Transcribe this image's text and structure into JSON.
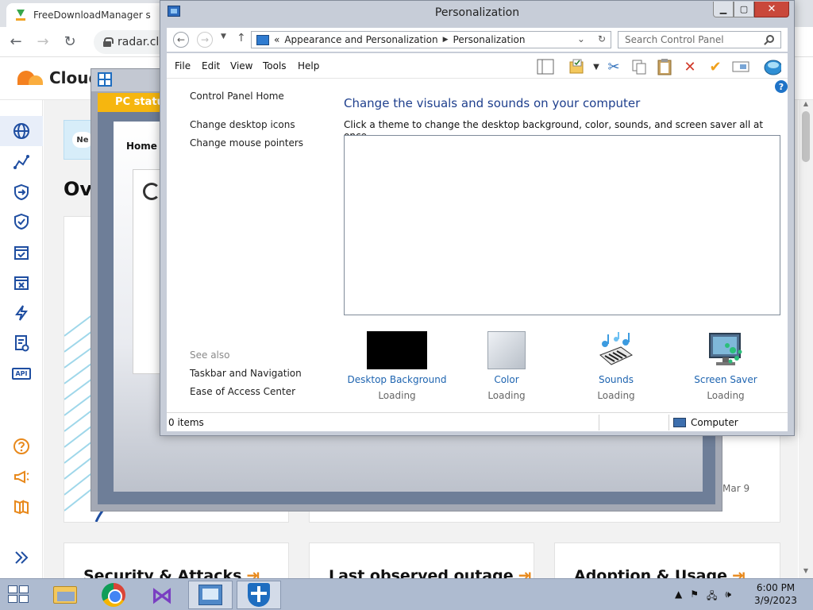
{
  "browser": {
    "tab_title": "FreeDownloadManager s",
    "url": "radar.clou",
    "brand": "Cloud",
    "notice_badge": "Ne",
    "overview_title": "Ove",
    "chart_date": "Mar 9",
    "cards": [
      {
        "title": "Security & Attacks"
      },
      {
        "title": "Last observed outage"
      },
      {
        "title": "Adoption & Usage"
      }
    ],
    "sidebar_api": "API"
  },
  "pc_status": {
    "banner": "PC status",
    "home": "Home"
  },
  "window": {
    "title": "Personalization",
    "breadcrumb_prefix": "«",
    "breadcrumb": [
      "Appearance and Personalization",
      "Personalization"
    ],
    "search_placeholder": "Search Control Panel",
    "menu": [
      "File",
      "Edit",
      "View",
      "Tools",
      "Help"
    ],
    "left_links": [
      "Control Panel Home",
      "Change desktop icons",
      "Change mouse pointers"
    ],
    "see_also_label": "See also",
    "see_also_links": [
      "Taskbar and Navigation",
      "Ease of Access Center"
    ],
    "heading": "Change the visuals and sounds on your computer",
    "subheading": "Click a theme to change the desktop background, color, sounds, and screen saver all at once.",
    "settings": [
      {
        "label": "Desktop Background",
        "status": "Loading",
        "icon": "desktop-background-thumbnail"
      },
      {
        "label": "Color",
        "status": "Loading",
        "icon": "color-thumbnail"
      },
      {
        "label": "Sounds",
        "status": "Loading",
        "icon": "sounds-icon"
      },
      {
        "label": "Screen Saver",
        "status": "Loading",
        "icon": "screen-saver-icon"
      }
    ],
    "status_items": "0 items",
    "status_location": "Computer"
  },
  "taskbar": {
    "time": "6:00 PM",
    "date": "3/9/2023"
  },
  "colors": {
    "link_blue": "#1e64b0",
    "heading_blue": "#1e3f8d",
    "close_red": "#c9483b",
    "cloudflare_orange": "#f48120",
    "pc_status_yellow": "#f6b60f"
  }
}
